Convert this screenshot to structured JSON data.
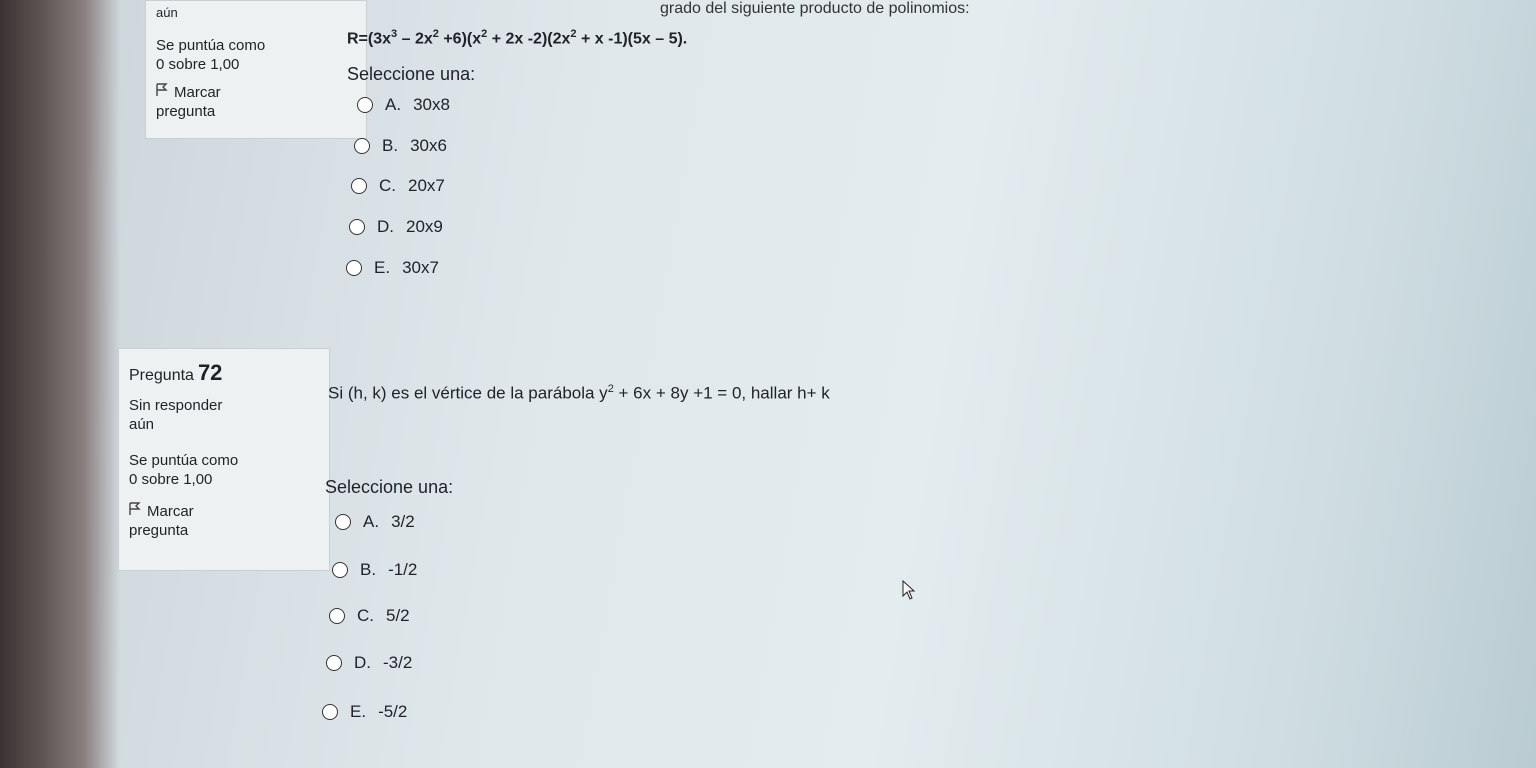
{
  "question71": {
    "header_partial": "grado del siguiente producto de polinomios:",
    "status_tail": "aún",
    "score_label": "Se puntúa como",
    "score_value": "0 sobre 1,00",
    "flag_label": "Marcar",
    "flag_label2": "pregunta",
    "expression": {
      "a": "R=(3x",
      "b": " – 2x",
      "c": " +6)(x",
      "d": " + 2x -2)(2x",
      "e": " + x -1)(5x – 5).",
      "exp3": "3",
      "exp2": "2"
    },
    "select_label": "Seleccione una:",
    "options": [
      {
        "letter": "A.",
        "text": "30x8"
      },
      {
        "letter": "B.",
        "text": "30x6"
      },
      {
        "letter": "C.",
        "text": "20x7"
      },
      {
        "letter": "D.",
        "text": "20x9"
      },
      {
        "letter": "E.",
        "text": "30x7"
      }
    ]
  },
  "question72": {
    "question_label": "Pregunta",
    "question_number": "72",
    "status_line1": "Sin responder",
    "status_line2": "aún",
    "score_label": "Se puntúa como",
    "score_value": "0 sobre 1,00",
    "flag_label": "Marcar",
    "flag_label2": "pregunta",
    "statement": {
      "a": "Si (h, k) es el vértice de la parábola y",
      "exp": "2",
      "b": " + 6x + 8y +1 = 0, hallar h+ k"
    },
    "select_label": "Seleccione una:",
    "options": [
      {
        "letter": "A.",
        "text": "3/2"
      },
      {
        "letter": "B.",
        "text": "-1/2"
      },
      {
        "letter": "C.",
        "text": "5/2"
      },
      {
        "letter": "D.",
        "text": "-3/2"
      },
      {
        "letter": "E.",
        "text": "-5/2"
      }
    ]
  }
}
